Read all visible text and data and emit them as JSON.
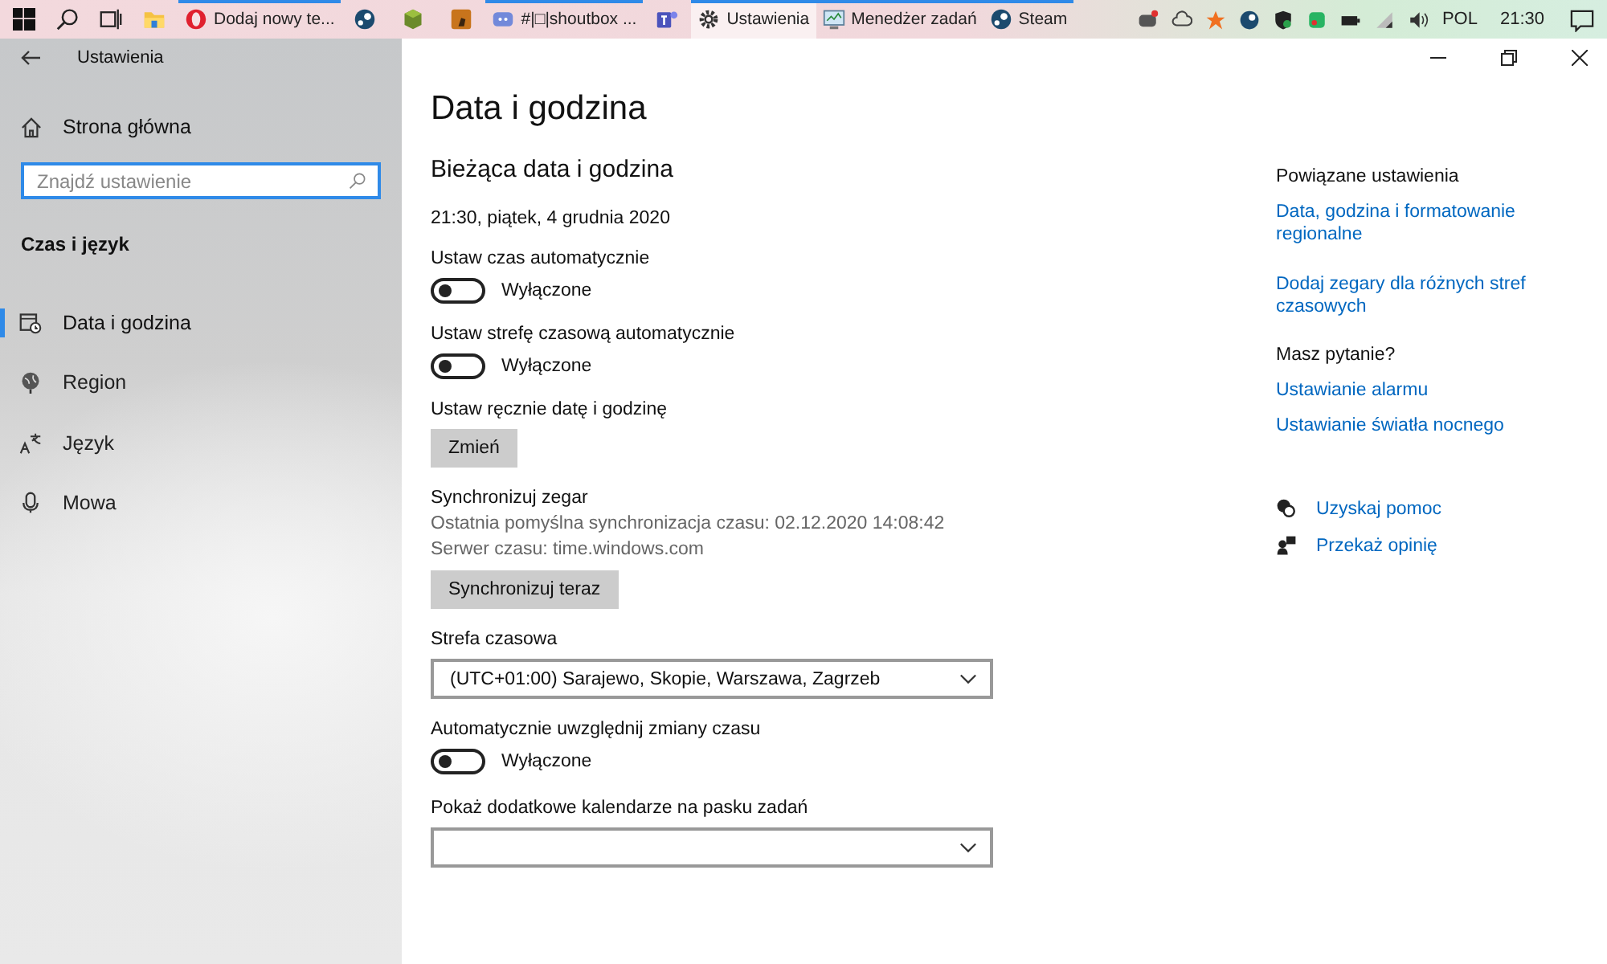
{
  "taskbar": {
    "apps": [
      {
        "label": "Dodaj nowy te...",
        "running": true,
        "selected": false
      },
      {
        "running": false,
        "selected": false
      },
      {
        "running": false,
        "selected": false
      },
      {
        "running": false,
        "selected": false
      },
      {
        "label": "#|□|shoutbox ...",
        "running": true,
        "selected": false
      },
      {
        "running": false,
        "selected": false
      },
      {
        "label": "Ustawienia",
        "running": true,
        "selected": true
      },
      {
        "label": "Menedżer zadań",
        "running": true,
        "selected": false
      },
      {
        "label": "Steam",
        "running": true,
        "selected": false
      }
    ],
    "language": "POL",
    "clock": "21:30"
  },
  "sidebar": {
    "title": "Ustawienia",
    "home": "Strona główna",
    "search": {
      "placeholder": "Znajdź ustawienie"
    },
    "heading": "Czas i język",
    "items": [
      {
        "label": "Data i godzina",
        "selected": true
      },
      {
        "label": "Region",
        "selected": false
      },
      {
        "label": "Język",
        "selected": false
      },
      {
        "label": "Mowa",
        "selected": false
      }
    ]
  },
  "content": {
    "title": "Data i godzina",
    "section": "Bieżąca data i godzina",
    "current": "21:30, piątek, 4 grudnia 2020",
    "settings": [
      {
        "kind": "toggle",
        "label": "Ustaw czas automatycznie",
        "on": false,
        "state_text": "Wyłączone"
      },
      {
        "kind": "toggle",
        "label": "Ustaw strefę czasową automatycznie",
        "on": false,
        "state_text": "Wyłączone"
      },
      {
        "kind": "button",
        "label": "Ustaw ręcznie datę i godzinę",
        "button": "Zmień"
      },
      {
        "kind": "button",
        "label": "Synchronizuj zegar",
        "lines": [
          "Ostatnia pomyślna synchronizacja czasu: 02.12.2020 14:08:42",
          "Serwer czasu: time.windows.com"
        ],
        "button": "Synchronizuj teraz"
      },
      {
        "kind": "dropdown",
        "label": "Strefa czasowa",
        "value": "(UTC+01:00) Sarajewo, Skopie, Warszawa, Zagrzeb"
      },
      {
        "kind": "toggle",
        "label": "Automatycznie uwzględnij zmiany czasu",
        "on": false,
        "state_text": "Wyłączone"
      },
      {
        "kind": "dropdown",
        "label": "Pokaż dodatkowe kalendarze na pasku zadań"
      }
    ]
  },
  "related": {
    "heading": "Powiązane ustawienia",
    "links": [
      "Data, godzina i formatowanie regionalne",
      "Dodaj zegary dla różnych stref czasowych"
    ],
    "question": "Masz pytanie?",
    "help_links": [
      "Ustawianie alarmu",
      "Ustawianie światła nocnego"
    ],
    "actions": [
      "Uzyskaj pomoc",
      "Przekaż opinię"
    ]
  }
}
